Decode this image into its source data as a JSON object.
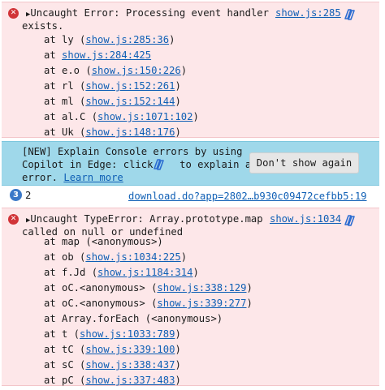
{
  "error1": {
    "message_line1": "Uncaught Error: Processing event handler",
    "message_line2": "exists.",
    "source": "show.js:285",
    "stack": [
      {
        "prefix": "at ly (",
        "link": "show.js:285:36",
        "suffix": ")"
      },
      {
        "prefix": "at ",
        "link": "show.js:284:425",
        "suffix": ""
      },
      {
        "prefix": "at e.o (",
        "link": "show.js:150:226",
        "suffix": ")"
      },
      {
        "prefix": "at rl (",
        "link": "show.js:152:261",
        "suffix": ")"
      },
      {
        "prefix": "at ml (",
        "link": "show.js:152:144",
        "suffix": ")"
      },
      {
        "prefix": "at al.C (",
        "link": "show.js:1071:102",
        "suffix": ")"
      },
      {
        "prefix": "at Uk (",
        "link": "show.js:148:176",
        "suffix": ")"
      }
    ]
  },
  "info": {
    "line1": "[NEW] Explain Console errors by using",
    "line2a": "Copilot in Edge: click ",
    "line2b": " to explain an",
    "line3a": "error. ",
    "learn_more": "Learn more",
    "dismiss_label": "Don't show again"
  },
  "group": {
    "count": "3",
    "count2": "2",
    "source": "download.do?app=2802…b930c09472cefbb5:19"
  },
  "error2": {
    "message_line1": "Uncaught TypeError: Array.prototype.map",
    "message_line2": "called on null or undefined",
    "source": "show.js:1034",
    "stack": [
      {
        "prefix": "at map (<anonymous>)",
        "link": "",
        "suffix": ""
      },
      {
        "prefix": "at ob (",
        "link": "show.js:1034:225",
        "suffix": ")"
      },
      {
        "prefix": "at f.Jd (",
        "link": "show.js:1184:314",
        "suffix": ")"
      },
      {
        "prefix": "at oC.<anonymous> (",
        "link": "show.js:338:129",
        "suffix": ")"
      },
      {
        "prefix": "at oC.<anonymous> (",
        "link": "show.js:339:277",
        "suffix": ")"
      },
      {
        "prefix": "at Array.forEach (<anonymous>)",
        "link": "",
        "suffix": ""
      },
      {
        "prefix": "at t (",
        "link": "show.js:1033:789",
        "suffix": ")"
      },
      {
        "prefix": "at tC (",
        "link": "show.js:339:100",
        "suffix": ")"
      },
      {
        "prefix": "at sC (",
        "link": "show.js:338:437",
        "suffix": ")"
      },
      {
        "prefix": "at pC (",
        "link": "show.js:337:483",
        "suffix": ")"
      }
    ]
  },
  "colors": {
    "error_bg": "#fde7e9",
    "error_icon": "#d13438",
    "info_bg": "#9fd8ea",
    "link": "#0f5fb5",
    "badge": "#3a78c8"
  }
}
